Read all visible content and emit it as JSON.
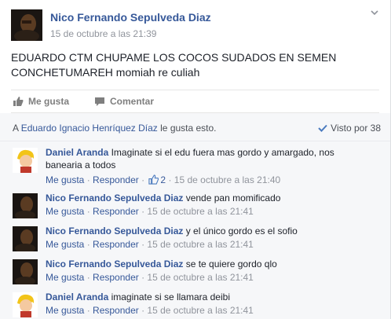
{
  "post": {
    "author": "Nico Fernando Sepulveda Diaz",
    "timestamp": "15 de octubre a las 21:39",
    "text": "EDUARDO CTM CHUPAME LOS COCOS SUDADOS EN SEMEN CONCHETUMAREH momiah re culiah"
  },
  "actions": {
    "like": "Me gusta",
    "comment": "Comentar"
  },
  "summary": {
    "likes_prefix": "A",
    "likes_name": "Eduardo Ignacio Henríquez Díaz",
    "likes_suffix": "le gusta esto.",
    "seen": "Visto por 38"
  },
  "comments": [
    {
      "author": "Daniel Aranda",
      "text": "Imaginate si el edu fuera mas gordo y amargado, nos banearia a todos",
      "like_label": "Me gusta",
      "reply_label": "Responder",
      "like_count": "2",
      "timestamp": "15 de octubre a las 21:40",
      "avatar": "blond"
    },
    {
      "author": "Nico Fernando Sepulveda Diaz",
      "text": "vende pan momificado",
      "like_label": "Me gusta",
      "reply_label": "Responder",
      "like_count": "",
      "timestamp": "15 de octubre a las 21:41",
      "avatar": "dark"
    },
    {
      "author": "Nico Fernando Sepulveda Diaz",
      "text": "y el único gordo es el sofio",
      "like_label": "Me gusta",
      "reply_label": "Responder",
      "like_count": "",
      "timestamp": "15 de octubre a las 21:41",
      "avatar": "dark"
    },
    {
      "author": "Nico Fernando Sepulveda Diaz",
      "text": "se te quiere gordo qlo",
      "like_label": "Me gusta",
      "reply_label": "Responder",
      "like_count": "",
      "timestamp": "15 de octubre a las 21:41",
      "avatar": "dark"
    },
    {
      "author": "Daniel Aranda",
      "text": "imaginate si se llamara deibi",
      "like_label": "Me gusta",
      "reply_label": "Responder",
      "like_count": "",
      "timestamp": "15 de octubre a las 21:41",
      "avatar": "blond"
    }
  ],
  "colors": {
    "link": "#365899",
    "muted": "#90949c",
    "background": "#f6f7f9"
  }
}
